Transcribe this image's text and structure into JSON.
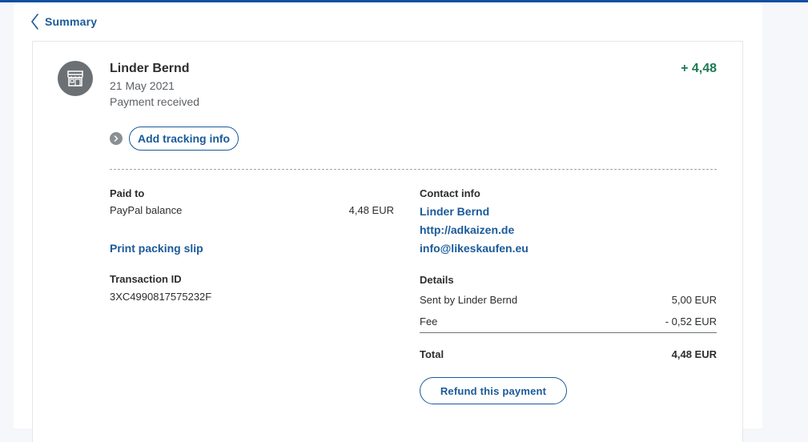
{
  "nav": {
    "back_label": "Summary",
    "back_icon": "chevron-left-icon"
  },
  "header": {
    "icon": "storefront-icon",
    "name": "Linder Bernd",
    "date": "21 May 2021",
    "status": "Payment received",
    "amount": "+ 4,48",
    "amount_color": "#1b7a52"
  },
  "actions": {
    "expand_icon": "chevron-right-icon",
    "tracking_label": "Add tracking info",
    "print_slip_label": "Print packing slip",
    "refund_label": "Refund this payment"
  },
  "paid_to": {
    "heading": "Paid to",
    "method": "PayPal balance",
    "amount": "4,48 EUR"
  },
  "transaction": {
    "heading": "Transaction ID",
    "id": "3XC4990817575232F"
  },
  "contact": {
    "heading": "Contact info",
    "name": "Linder Bernd",
    "website": "http://adkaizen.de",
    "email": "info@likeskaufen.eu"
  },
  "details": {
    "heading": "Details",
    "rows": [
      {
        "label": "Sent by Linder Bernd",
        "value": "5,00 EUR"
      },
      {
        "label": "Fee",
        "value": "- 0,52 EUR"
      }
    ],
    "total_label": "Total",
    "total_value": "4,48 EUR"
  },
  "colors": {
    "link": "#1a5a9a",
    "accent_bar": "#0d4fa3",
    "positive": "#1b7a52"
  }
}
